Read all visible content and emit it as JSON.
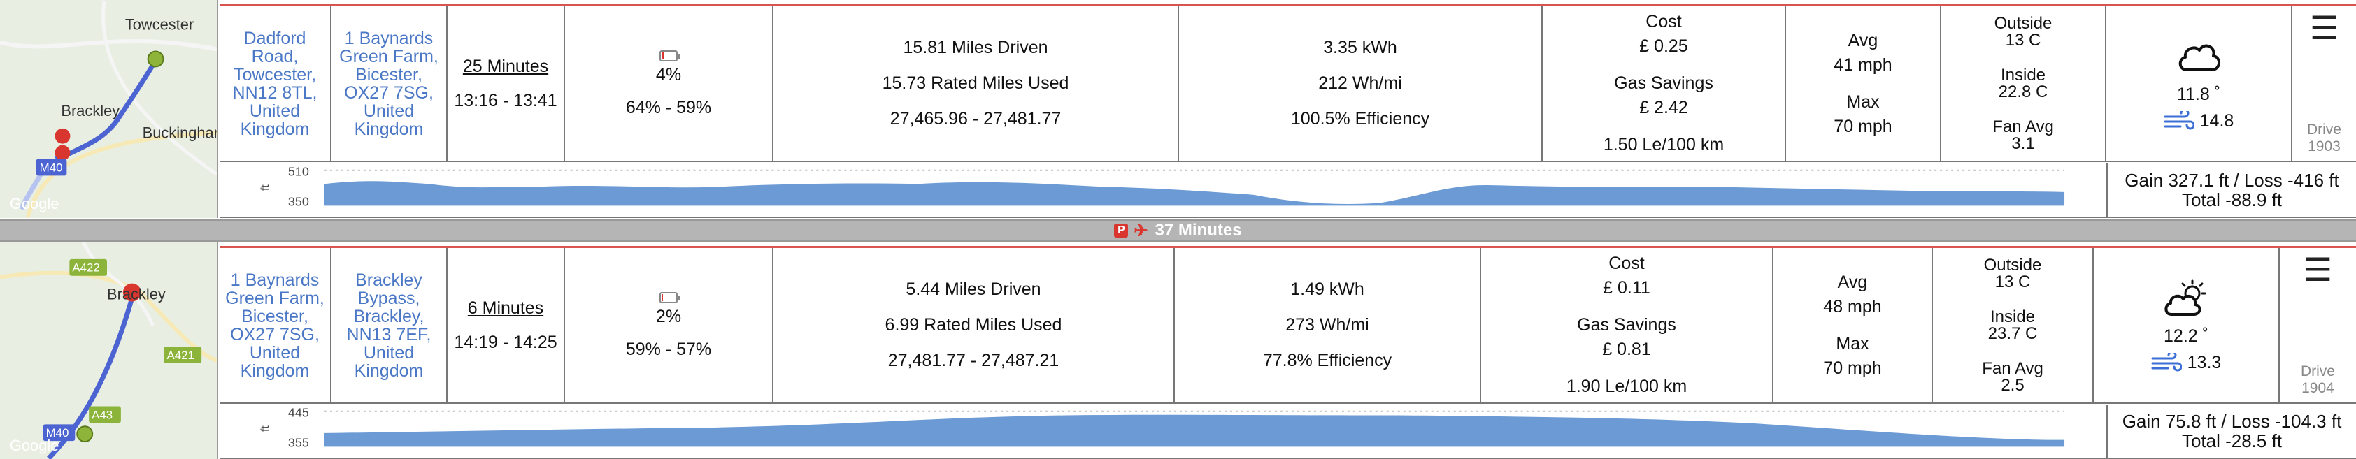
{
  "drives": [
    {
      "map": {
        "place_labels": [
          "Towcester",
          "Brackley",
          "Buckingham"
        ],
        "road_badge": "M40",
        "watermark": "Google"
      },
      "start_address": "Dadford Road, Towcester, NN12 8TL, United Kingdom",
      "end_address": "1 Baynards Green Farm, Bicester, OX27 7SG, United Kingdom",
      "duration": "25 Minutes",
      "time_range": "13:16 - 13:41",
      "battery_percent": "4%",
      "battery_range": "64% - 59%",
      "battery_level": 0.04,
      "miles_driven": "15.81 Miles Driven",
      "rated_miles": "15.73 Rated Miles Used",
      "odometer": "27,465.96 - 27,481.77",
      "energy": "3.35 kWh",
      "efficiency_whmi": "212 Wh/mi",
      "efficiency_pct": "100.5% Efficiency",
      "cost_label": "Cost",
      "cost_value": "£ 0.25",
      "gas_label": "Gas Savings",
      "gas_value": "£ 2.42",
      "consumption": "1.50 Le/100 km",
      "avg_label": "Avg",
      "avg_value": "41 mph",
      "max_label": "Max",
      "max_value": "70 mph",
      "outside_label": "Outside",
      "outside_value": "13 C",
      "inside_label": "Inside",
      "inside_value": "22.8 C",
      "fan_label": "Fan Avg",
      "fan_value": "3.1",
      "weather_icon": "cloud-icon",
      "weather_temp": "11.8 ˚",
      "wind_speed": "14.8",
      "drive_label": "Drive",
      "drive_number": "1903",
      "elev_axis_unit": "ft",
      "elev_tick_top": "510",
      "elev_tick_bottom": "350",
      "gain_loss": "Gain 327.1 ft / Loss -416 ft",
      "total": "Total -88.9 ft"
    },
    {
      "map": {
        "place_labels": [
          "Brackley"
        ],
        "road_badges": [
          "A422",
          "A421",
          "A43",
          "M40"
        ],
        "watermark": "Google"
      },
      "start_address": "1 Baynards Green Farm, Bicester, OX27 7SG, United Kingdom",
      "end_address": "Brackley Bypass, Brackley, NN13 7EF, United Kingdom",
      "duration": "6 Minutes",
      "time_range": "14:19 - 14:25",
      "battery_percent": "2%",
      "battery_range": "59% - 57%",
      "battery_level": 0.02,
      "miles_driven": "5.44 Miles Driven",
      "rated_miles": "6.99 Rated Miles Used",
      "odometer": "27,481.77 - 27,487.21",
      "energy": "1.49 kWh",
      "efficiency_whmi": "273 Wh/mi",
      "efficiency_pct": "77.8% Efficiency",
      "cost_label": "Cost",
      "cost_value": "£ 0.11",
      "gas_label": "Gas Savings",
      "gas_value": "£ 0.81",
      "consumption": "1.90 Le/100 km",
      "avg_label": "Avg",
      "avg_value": "48 mph",
      "max_label": "Max",
      "max_value": "70 mph",
      "outside_label": "Outside",
      "outside_value": "13 C",
      "inside_label": "Inside",
      "inside_value": "23.7 C",
      "fan_label": "Fan Avg",
      "fan_value": "2.5",
      "weather_icon": "partly-cloudy-icon",
      "weather_temp": "12.2 ˚",
      "wind_speed": "13.3",
      "drive_label": "Drive",
      "drive_number": "1904",
      "elev_axis_unit": "ft",
      "elev_tick_top": "445",
      "elev_tick_bottom": "355",
      "gain_loss": "Gain 75.8 ft / Loss -104.3 ft",
      "total": "Total -28.5 ft"
    }
  ],
  "parking": {
    "label": "37 Minutes",
    "p_icon": "P"
  },
  "colors": {
    "accent_red": "#d9534f",
    "link_blue": "#4a78c6",
    "elevation_fill": "#6b9ad4",
    "route_blue": "#4c63d2"
  }
}
